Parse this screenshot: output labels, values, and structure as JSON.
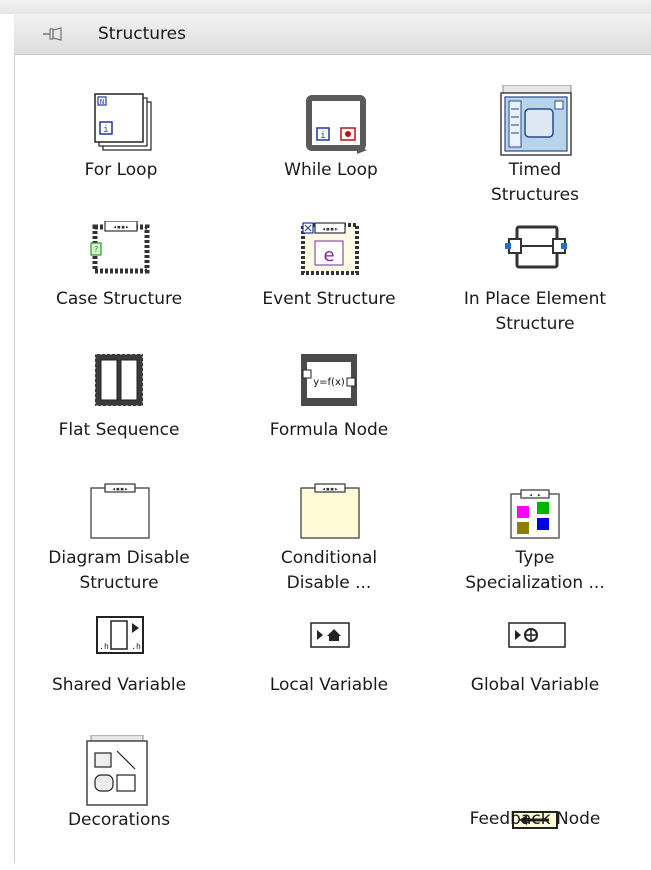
{
  "palette": {
    "title": "Structures",
    "pin_icon": "pin-icon",
    "items": [
      {
        "label": "For Loop",
        "icon": "for-loop-icon"
      },
      {
        "label": "While Loop",
        "icon": "while-loop-icon"
      },
      {
        "label_lines": [
          "Timed",
          "Structures"
        ],
        "icon": "timed-structures-icon"
      },
      {
        "label": "Case Structure",
        "icon": "case-structure-icon"
      },
      {
        "label": "Event Structure",
        "icon": "event-structure-icon"
      },
      {
        "label_lines": [
          "In Place Element",
          "Structure"
        ],
        "icon": "in-place-element-structure-icon"
      },
      {
        "label": "Flat Sequence",
        "icon": "flat-sequence-icon"
      },
      {
        "label": "Formula Node",
        "icon": "formula-node-icon"
      },
      {
        "label_lines": [
          "Diagram Disable",
          "Structure"
        ],
        "icon": "diagram-disable-structure-icon"
      },
      {
        "label_lines": [
          "Conditional",
          "Disable ..."
        ],
        "icon": "conditional-disable-icon"
      },
      {
        "label_lines": [
          "Type",
          "Specialization ..."
        ],
        "icon": "type-specialization-icon"
      },
      {
        "label": "Shared Variable",
        "icon": "shared-variable-icon"
      },
      {
        "label": "Local Variable",
        "icon": "local-variable-icon"
      },
      {
        "label": "Global Variable",
        "icon": "global-variable-icon"
      },
      {
        "label": "Decorations",
        "icon": "decorations-icon"
      },
      {
        "label": "Feedback Node",
        "icon": "feedback-node-icon"
      }
    ],
    "formula_text": "y=f(x)",
    "event_glyph": "e",
    "colors": {
      "titlebar": "#e4e4e4",
      "loop_frame": "#555555",
      "event_frame_fill": "#fdfbe6",
      "conditional_fill": "#fffbd6",
      "magenta": "#ff00ff",
      "green": "#00b400",
      "olive": "#8a7f00",
      "blue": "#0000e0"
    }
  }
}
